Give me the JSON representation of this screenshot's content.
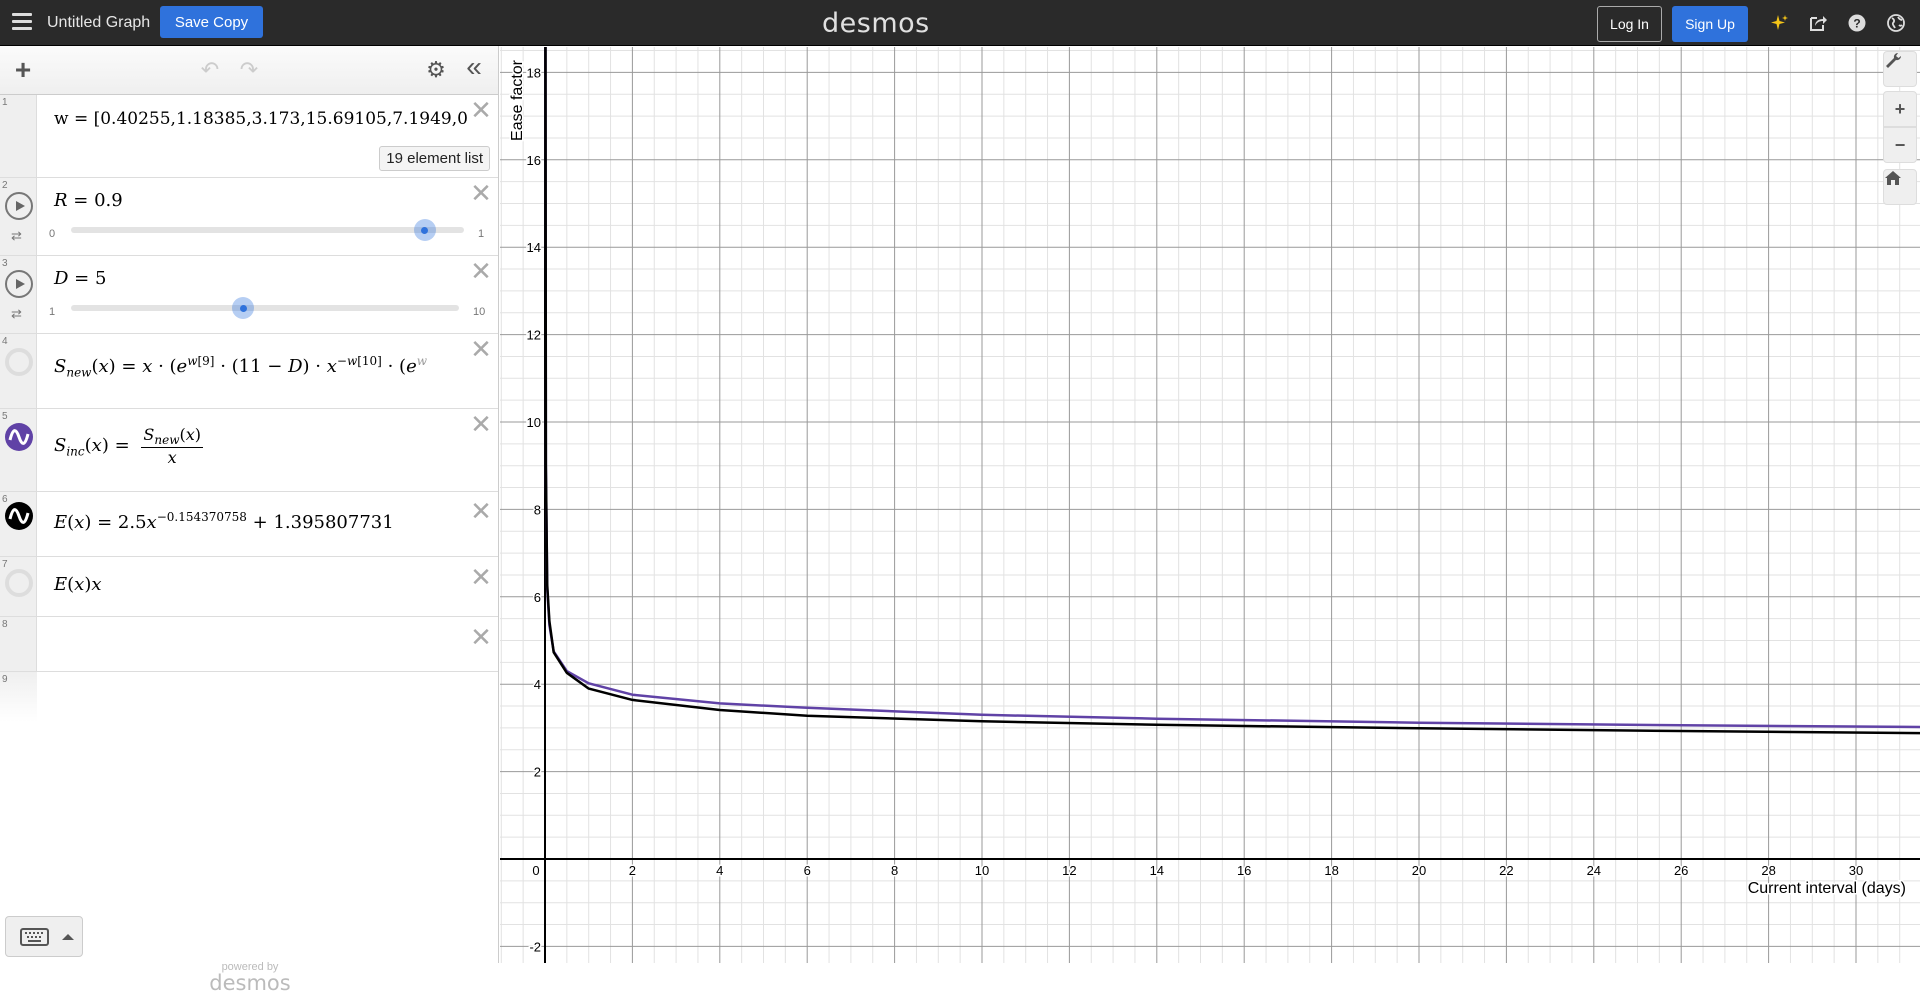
{
  "topbar": {
    "title": "Untitled Graph",
    "save_copy": "Save Copy",
    "brand": "desmos",
    "login": "Log In",
    "signup": "Sign Up",
    "icons": [
      "sparkle-icon",
      "share-icon",
      "help-icon",
      "globe-icon"
    ]
  },
  "sidebar": {
    "toolbar": {
      "add": "+",
      "undo": "↶",
      "redo": "↷",
      "settings": "⚙",
      "collapse": "«"
    },
    "expressions": [
      {
        "num": "1",
        "latex": "w = [0.40255,1.18385,3.173,15.69105,7.1949,0",
        "badge": "19 element list"
      },
      {
        "num": "2",
        "lhs": "R",
        "value": "0.9",
        "slider": {
          "min": "0",
          "max": "1",
          "fraction": 0.9
        }
      },
      {
        "num": "3",
        "lhs": "D",
        "value": "5",
        "slider": {
          "min": "1",
          "max": "10",
          "fraction": 0.444
        }
      },
      {
        "num": "4",
        "text": "S_new(x) = x · (e^{w[9]} · (11 − D) · x^{−w[10]} · (e^w",
        "visible": false
      },
      {
        "num": "5",
        "text": "S_inc(x) = S_new(x) / x",
        "color": "#6042a6",
        "visible": true
      },
      {
        "num": "6",
        "text": "E(x) = 2.5x^{−0.154370758} + 1.395807731",
        "coef": "2.5",
        "exp": "−0.154370758",
        "const": "1.395807731",
        "color": "#000000",
        "visible": true
      },
      {
        "num": "7",
        "text": "E(x)x",
        "visible": false
      },
      {
        "num": "8",
        "text": ""
      },
      {
        "num": "9",
        "text": ""
      }
    ],
    "powered_by": "powered by",
    "powered_brand": "desmos"
  },
  "graph_controls": {
    "settings": "wrench-icon",
    "zoom_in": "+",
    "zoom_out": "−",
    "home": "home-icon"
  },
  "chart_data": {
    "type": "line",
    "title": "",
    "xlabel": "Current interval (days)",
    "ylabel": "Ease factor",
    "xlim": [
      -1,
      31.5
    ],
    "ylim": [
      -2.4,
      18.5
    ],
    "x_ticks": [
      0,
      2,
      4,
      6,
      8,
      10,
      12,
      14,
      16,
      18,
      20,
      22,
      24,
      26,
      28,
      30
    ],
    "y_ticks": [
      -2,
      2,
      4,
      6,
      8,
      10,
      12,
      14,
      16,
      18
    ],
    "grid": true,
    "series": [
      {
        "name": "S_inc(x)",
        "color": "#6042a6",
        "x": [
          0.05,
          0.1,
          0.2,
          0.5,
          1,
          2,
          4,
          6,
          10,
          14,
          20,
          26,
          31.5
        ],
        "y": [
          6.2,
          5.35,
          4.75,
          4.3,
          4.02,
          3.76,
          3.56,
          3.46,
          3.3,
          3.21,
          3.12,
          3.06,
          3.02
        ]
      },
      {
        "name": "E(x)",
        "color": "#000000",
        "x": [
          0.05,
          0.1,
          0.2,
          0.5,
          1,
          2,
          4,
          6,
          10,
          14,
          20,
          26,
          31.5
        ],
        "y": [
          6.28,
          5.44,
          4.73,
          4.26,
          3.9,
          3.64,
          3.41,
          3.28,
          3.15,
          3.07,
          2.99,
          2.93,
          2.88
        ]
      }
    ]
  }
}
